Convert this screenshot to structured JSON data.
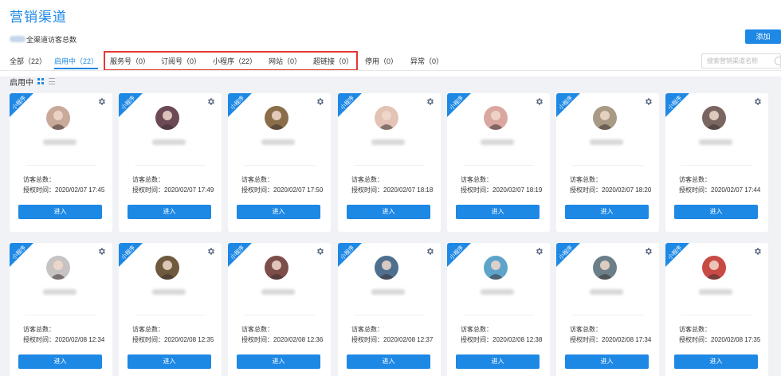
{
  "header": {
    "title": "营销渠道",
    "total_visitors_label": "全渠道访客总数",
    "add_button": "添加"
  },
  "tabs": [
    {
      "label": "全部（22）"
    },
    {
      "label": "启用中（22）"
    },
    {
      "label": "服务号（0）"
    },
    {
      "label": "订阅号（0）"
    },
    {
      "label": "小程序（22）"
    },
    {
      "label": "网站（0）"
    },
    {
      "label": "超链接（0）"
    },
    {
      "label": "停用（0）"
    },
    {
      "label": "异常（0）"
    }
  ],
  "search": {
    "placeholder": "搜索营销渠道名称"
  },
  "status_label": "启用中",
  "card_common": {
    "ribbon": "小程序",
    "visits_label": "访客总数：",
    "auth_label": "授权时间：",
    "enter_button": "进入"
  },
  "cards": [
    {
      "auth_time": "2020/02/07 17:45",
      "avatar_color": "#c9a99a"
    },
    {
      "auth_time": "2020/02/07 17:49",
      "avatar_color": "#6b4a55"
    },
    {
      "auth_time": "2020/02/07 17:50",
      "avatar_color": "#8a6e4a"
    },
    {
      "auth_time": "2020/02/07 18:18",
      "avatar_color": "#e3c3b5"
    },
    {
      "auth_time": "2020/02/07 18:19",
      "avatar_color": "#d9a7a0"
    },
    {
      "auth_time": "2020/02/07 18:20",
      "avatar_color": "#a89a84"
    },
    {
      "auth_time": "2020/02/07 17:44",
      "avatar_color": "#7a6660"
    },
    {
      "auth_time": "2020/02/08 12:34",
      "avatar_color": "#c8c3c3"
    },
    {
      "auth_time": "2020/02/08 12:35",
      "avatar_color": "#6e5a3c"
    },
    {
      "auth_time": "2020/02/08 12:36",
      "avatar_color": "#7d4d4a"
    },
    {
      "auth_time": "2020/02/08 12:37",
      "avatar_color": "#4f6f8f"
    },
    {
      "auth_time": "2020/02/08 12:38",
      "avatar_color": "#5ea3c9"
    },
    {
      "auth_time": "2020/02/08 17:34",
      "avatar_color": "#6a7f88"
    },
    {
      "auth_time": "2020/02/08 17:35",
      "avatar_color": "#c94a45"
    }
  ],
  "colors": {
    "accent": "#1e88e5",
    "highlight": "#e53935"
  }
}
